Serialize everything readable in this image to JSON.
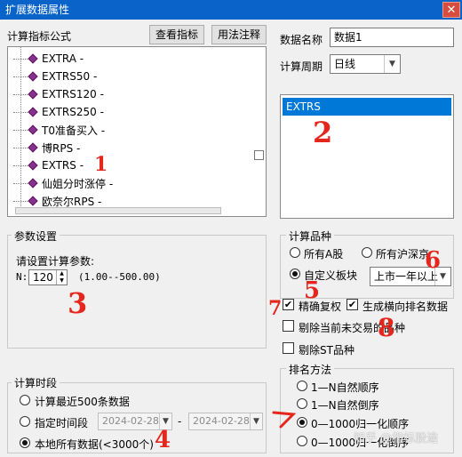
{
  "window": {
    "title": "扩展数据属性",
    "close_glyph": "✕"
  },
  "formula": {
    "label": "计算指标公式",
    "view_button": "查看指标",
    "usage_button": "用法注释",
    "items": [
      {
        "name": "EXTRA -"
      },
      {
        "name": "EXTRS50 -"
      },
      {
        "name": "EXTRS120 -"
      },
      {
        "name": "EXTRS250 -"
      },
      {
        "name": "T0准备买入 -"
      },
      {
        "name": "博RPS -"
      },
      {
        "name": "EXTRS -"
      },
      {
        "name": "仙姐分时涨停 -"
      },
      {
        "name": "欧奈尔RPS -"
      }
    ]
  },
  "data_name": {
    "label": "数据名称",
    "value": "数据1"
  },
  "period": {
    "label": "计算周期",
    "value": "日线"
  },
  "indicator_list": {
    "selected": "EXTRS"
  },
  "params": {
    "legend": "参数设置",
    "prompt": "请设置计算参数:",
    "n_label": "N:",
    "n_value": "120",
    "range": "(1.00--500.00)"
  },
  "variety": {
    "legend": "计算品种",
    "opt_a_share": "所有A股",
    "opt_hs": "所有沪深京",
    "opt_custom": "自定义板块",
    "custom_value": "上市一年以上"
  },
  "options": {
    "fq": "精确复权",
    "rank": "生成横向排名数据",
    "exclude_suspended": "剔除当前未交易的品种",
    "exclude_st": "剔除ST品种"
  },
  "time": {
    "legend": "计算时段",
    "opt_recent": "计算最近500条数据",
    "opt_range": "指定时间段",
    "date_from": "2024-02-28",
    "date_sep": "-",
    "date_to": "2024-02-28",
    "opt_all": "本地所有数据(<3000个)"
  },
  "rank_method": {
    "legend": "排名方法",
    "opt1": "1—N自然顺序",
    "opt2": "1—N自然倒序",
    "opt3": "0—1000归一化顺序",
    "opt4": "0—1000归一化倒序"
  },
  "annotations": [
    "1",
    "2",
    "3",
    "4",
    "5",
    "6",
    "7",
    "8"
  ],
  "watermark": "知乎 @指标股途",
  "colors": {
    "accent": "#0078d7",
    "annotation": "#e5261d",
    "titlebar": "#0a63c9"
  }
}
